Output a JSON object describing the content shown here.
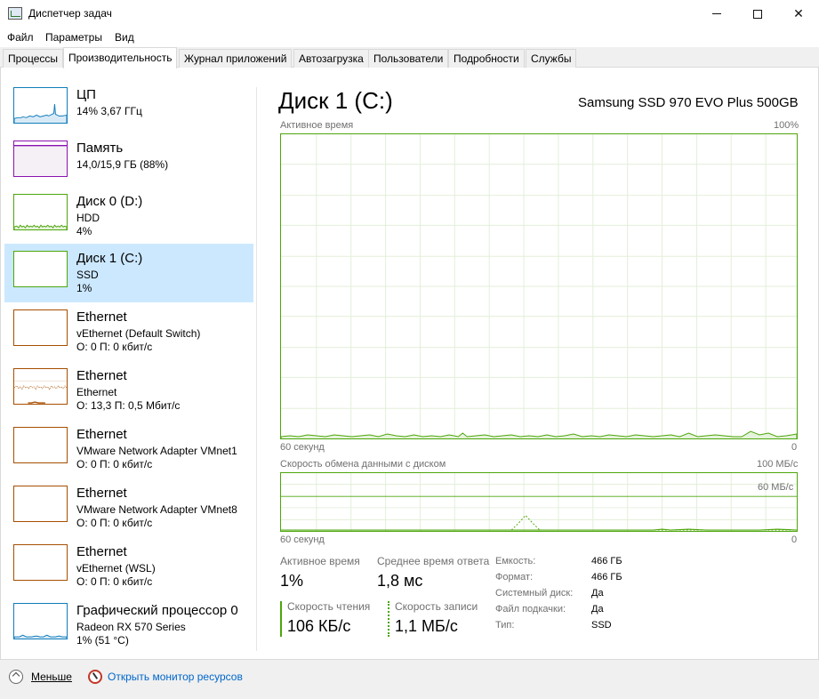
{
  "window": {
    "title": "Диспетчер задач"
  },
  "menu": {
    "file": "Файл",
    "params": "Параметры",
    "view": "Вид"
  },
  "tabs": [
    "Процессы",
    "Производительность",
    "Журнал приложений",
    "Автозагрузка",
    "Пользователи",
    "Подробности",
    "Службы"
  ],
  "active_tab": "Производительность",
  "sidebar": [
    {
      "title": "ЦП",
      "sub": "14% 3,67 ГГц",
      "sub2": "",
      "color": "#117dbb"
    },
    {
      "title": "Память",
      "sub": "14,0/15,9 ГБ (88%)",
      "sub2": "",
      "color": "#8b12ae",
      "level": 0.88
    },
    {
      "title": "Диск 0 (D:)",
      "sub": "HDD",
      "sub2": "4%",
      "color": "#4da60c"
    },
    {
      "title": "Диск 1 (C:)",
      "sub": "SSD",
      "sub2": "1%",
      "color": "#4da60c",
      "selected": true
    },
    {
      "title": "Ethernet",
      "sub": "vEthernet (Default Switch)",
      "sub2": "О: 0 П: 0 кбит/с",
      "color": "#a74f01"
    },
    {
      "title": "Ethernet",
      "sub": "Ethernet",
      "sub2": "О: 13,3 П: 0,5 Мбит/с",
      "color": "#a74f01"
    },
    {
      "title": "Ethernet",
      "sub": "VMware Network Adapter VMnet1",
      "sub2": "О: 0 П: 0 кбит/с",
      "color": "#a74f01"
    },
    {
      "title": "Ethernet",
      "sub": "VMware Network Adapter VMnet8",
      "sub2": "О: 0 П: 0 кбит/с",
      "color": "#a74f01"
    },
    {
      "title": "Ethernet",
      "sub": "vEthernet (WSL)",
      "sub2": "О: 0 П: 0 кбит/с",
      "color": "#a74f01"
    },
    {
      "title": "Графический процессор 0",
      "sub": "Radeon RX 570 Series",
      "sub2": "1% (51 °C)",
      "color": "#117dbb"
    }
  ],
  "detail": {
    "title": "Диск 1 (C:)",
    "model": "Samsung SSD 970 EVO Plus 500GB",
    "graph1": {
      "label": "Активное время",
      "max": "100%",
      "time": "60 секунд",
      "min": "0"
    },
    "graph2": {
      "label": "Скорость обмена данными с диском",
      "max": "100 МБ/с",
      "mid": "60 МБ/с",
      "time": "60 секунд",
      "min": "0"
    },
    "stats": {
      "active_time_label": "Активное время",
      "active_time_value": "1%",
      "response_label": "Среднее время ответа",
      "response_value": "1,8 мс",
      "read_label": "Скорость чтения",
      "read_value": "106 КБ/с",
      "write_label": "Скорость записи",
      "write_value": "1,1 МБ/с"
    },
    "props": [
      {
        "key": "Емкость:",
        "value": "466 ГБ"
      },
      {
        "key": "Формат:",
        "value": "466 ГБ"
      },
      {
        "key": "Системный диск:",
        "value": "Да"
      },
      {
        "key": "Файл подкачки:",
        "value": "Да"
      },
      {
        "key": "Тип:",
        "value": "SSD"
      }
    ]
  },
  "footer": {
    "less": "Меньше",
    "monitor": "Открыть монитор ресурсов"
  },
  "colors": {
    "disk": "#4da60c",
    "cpu": "#117dbb",
    "memory": "#8b12ae",
    "network": "#a74f01",
    "selected": "#cce8ff"
  }
}
